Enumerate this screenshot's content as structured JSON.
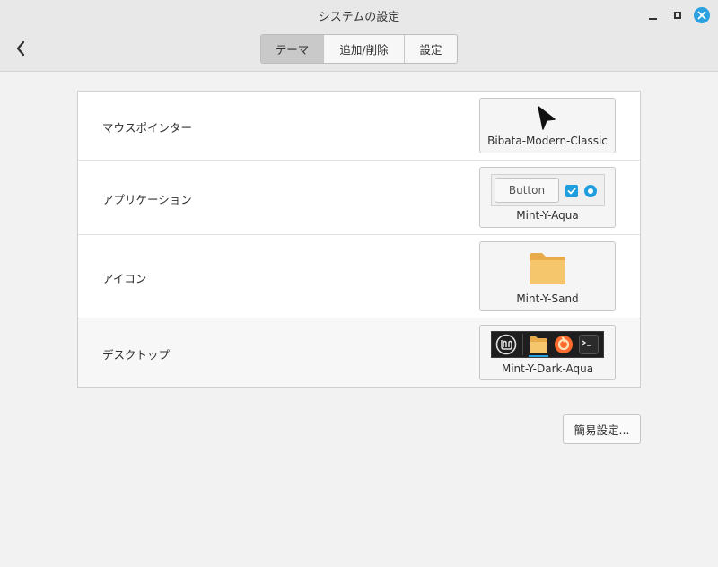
{
  "window": {
    "title": "システムの設定"
  },
  "tabs": [
    {
      "label": "テーマ",
      "selected": true
    },
    {
      "label": "追加/削除",
      "selected": false
    },
    {
      "label": "設定",
      "selected": false
    }
  ],
  "themes": {
    "mouse_pointer": {
      "label": "マウスポインター",
      "value": "Bibata-Modern-Classic"
    },
    "applications": {
      "label": "アプリケーション",
      "value": "Mint-Y-Aqua",
      "preview_button": "Button"
    },
    "icons": {
      "label": "アイコン",
      "value": "Mint-Y-Sand"
    },
    "desktop": {
      "label": "デスクトップ",
      "value": "Mint-Y-Dark-Aqua"
    }
  },
  "footer": {
    "simple_settings_button": "簡易設定..."
  },
  "colors": {
    "accent": "#2ba2e0",
    "folder": "#f6c66d",
    "titlebar": "#e8e8e8"
  }
}
